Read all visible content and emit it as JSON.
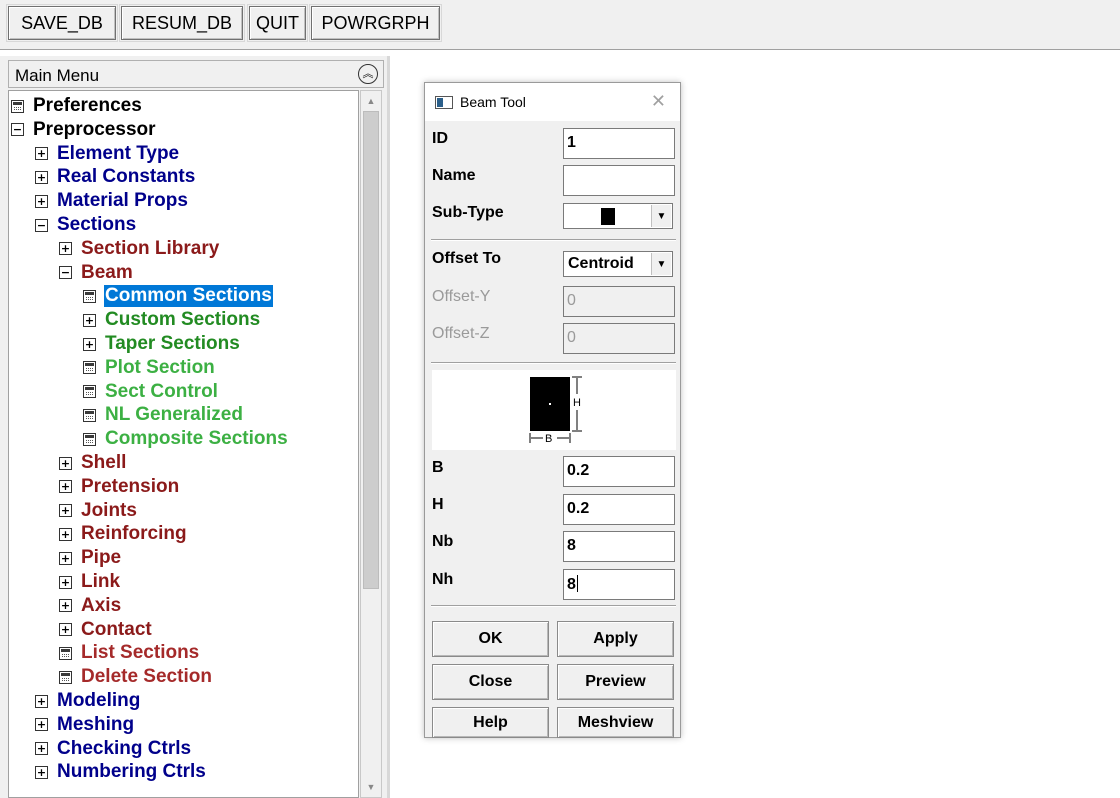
{
  "toolbar": {
    "buttons": [
      "SAVE_DB",
      "RESUM_DB",
      "QUIT",
      "POWRGRPH"
    ]
  },
  "main_menu": {
    "title": "Main Menu",
    "collapse_icon": "double-chevron-up-icon",
    "items": [
      {
        "label": "Preferences",
        "icon": "dialog-icon",
        "color": "#000000"
      },
      {
        "label": "Preprocessor",
        "icon": "expand-minus-icon",
        "color": "#000000"
      },
      {
        "label": "Element Type",
        "icon": "expand-plus-icon",
        "color": "#00008b"
      },
      {
        "label": "Real Constants",
        "icon": "expand-plus-icon",
        "color": "#00008b"
      },
      {
        "label": "Material Props",
        "icon": "expand-plus-icon",
        "color": "#00008b"
      },
      {
        "label": "Sections",
        "icon": "expand-minus-icon",
        "color": "#00008b"
      },
      {
        "label": "Section Library",
        "icon": "expand-plus-icon",
        "color": "#8b1a1a"
      },
      {
        "label": "Beam",
        "icon": "expand-minus-icon",
        "color": "#8b1a1a"
      },
      {
        "label": "Common Sections",
        "icon": "dialog-icon",
        "color": "#ffffff",
        "selected": true
      },
      {
        "label": "Custom Sections",
        "icon": "expand-plus-icon",
        "color": "#228b22"
      },
      {
        "label": "Taper Sections",
        "icon": "expand-plus-icon",
        "color": "#228b22"
      },
      {
        "label": "Plot Section",
        "icon": "dialog-icon",
        "color": "#3cb043"
      },
      {
        "label": "Sect Control",
        "icon": "dialog-icon",
        "color": "#3cb043"
      },
      {
        "label": "NL Generalized",
        "icon": "dialog-icon",
        "color": "#3cb043"
      },
      {
        "label": "Composite Sections",
        "icon": "dialog-icon",
        "color": "#3cb043"
      },
      {
        "label": "Shell",
        "icon": "expand-plus-icon",
        "color": "#8b1a1a"
      },
      {
        "label": "Pretension",
        "icon": "expand-plus-icon",
        "color": "#8b1a1a"
      },
      {
        "label": "Joints",
        "icon": "expand-plus-icon",
        "color": "#8b1a1a"
      },
      {
        "label": "Reinforcing",
        "icon": "expand-plus-icon",
        "color": "#8b1a1a"
      },
      {
        "label": "Pipe",
        "icon": "expand-plus-icon",
        "color": "#8b1a1a"
      },
      {
        "label": "Link",
        "icon": "expand-plus-icon",
        "color": "#8b1a1a"
      },
      {
        "label": "Axis",
        "icon": "expand-plus-icon",
        "color": "#8b1a1a"
      },
      {
        "label": "Contact",
        "icon": "expand-plus-icon",
        "color": "#8b1a1a"
      },
      {
        "label": "List Sections",
        "icon": "dialog-icon",
        "color": "#a52a2a"
      },
      {
        "label": "Delete Section",
        "icon": "dialog-icon",
        "color": "#a52a2a"
      },
      {
        "label": "Modeling",
        "icon": "expand-plus-icon",
        "color": "#00008b"
      },
      {
        "label": "Meshing",
        "icon": "expand-plus-icon",
        "color": "#00008b"
      },
      {
        "label": "Checking Ctrls",
        "icon": "expand-plus-icon",
        "color": "#00008b"
      },
      {
        "label": "Numbering Ctrls",
        "icon": "expand-plus-icon",
        "color": "#00008b"
      }
    ]
  },
  "beam_tool": {
    "title": "Beam Tool",
    "close_icon": "close-icon",
    "fields": {
      "id": {
        "label": "ID",
        "value": "1"
      },
      "name": {
        "label": "Name",
        "value": ""
      },
      "sub_type": {
        "label": "Sub-Type",
        "value_icon": "solid-rectangle-icon"
      },
      "offset_to": {
        "label": "Offset To",
        "value": "Centroid"
      },
      "offset_y": {
        "label": "Offset-Y",
        "value": "0"
      },
      "offset_z": {
        "label": "Offset-Z",
        "value": "0"
      },
      "b": {
        "label": "B",
        "value": "0.2"
      },
      "h": {
        "label": "H",
        "value": "0.2"
      },
      "nb": {
        "label": "Nb",
        "value": "8"
      },
      "nh": {
        "label": "Nh",
        "value": "8"
      }
    },
    "preview": {
      "h_label": "H",
      "b_label": "B"
    },
    "buttons": {
      "ok": "OK",
      "apply": "Apply",
      "close": "Close",
      "preview": "Preview",
      "help": "Help",
      "meshview": "Meshview"
    }
  }
}
